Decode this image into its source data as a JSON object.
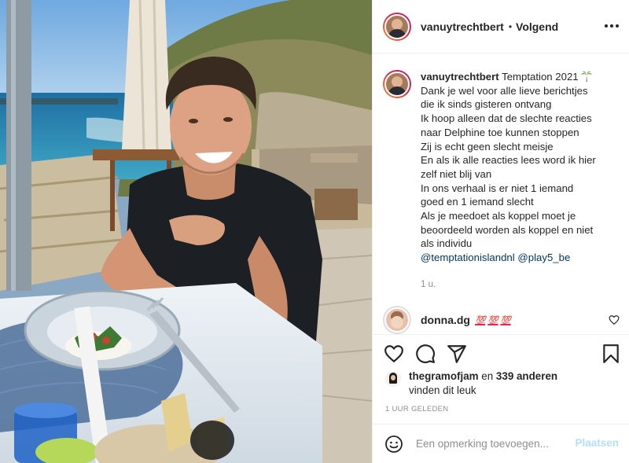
{
  "post": {
    "photo_description_icon": "post-photo",
    "header": {
      "username": "vanuytrechtbert",
      "separator": "•",
      "follow_label": "Volgend",
      "more_icon": "more-options-icon"
    },
    "caption": {
      "username": "vanuytrechtbert",
      "first_text": "Temptation 2021",
      "emoji_icon": "palm-tree-icon",
      "lines": [
        "Dank je wel voor alle lieve berichtjes",
        "die ik sinds gisteren ontvang",
        "Ik hoop alleen dat de slechte reacties",
        "naar Delphine toe kunnen stoppen",
        "Zij is echt geen slecht meisje",
        "En als ik alle reacties lees word ik hier",
        "zelf niet blij van",
        "In ons verhaal is er niet 1 iemand",
        "goed en 1 iemand slecht",
        "Als je meedoet als koppel moet je",
        "beoordeeld worden als koppel en niet",
        "als individu"
      ],
      "mentions": [
        "@temptationislandnl",
        "@play5_be"
      ],
      "time": "1 u."
    },
    "comments": [
      {
        "username": "donna.dg",
        "emojis": [
          "💯",
          "💯",
          "💯"
        ],
        "like_icon": "heart-outline-icon"
      }
    ],
    "actions": {
      "like_icon": "heart-icon",
      "comment_icon": "comment-bubble-icon",
      "share_icon": "paper-plane-icon",
      "save_icon": "bookmark-icon"
    },
    "likes": {
      "first_user": "thegramofjam",
      "connector": "en",
      "others": "339 anderen",
      "suffix": "vinden dit leuk"
    },
    "timestamp": "1 UUR GELEDEN",
    "add_comment": {
      "emoji_icon": "smiley-icon",
      "placeholder": "Een opmerking toevoegen...",
      "post_label": "Plaatsen"
    }
  },
  "colors": {
    "text": "#262626",
    "muted": "#8e8e8e",
    "mention": "#00376b",
    "post_button_disabled": "#b2dffc",
    "border": "#efefef"
  }
}
